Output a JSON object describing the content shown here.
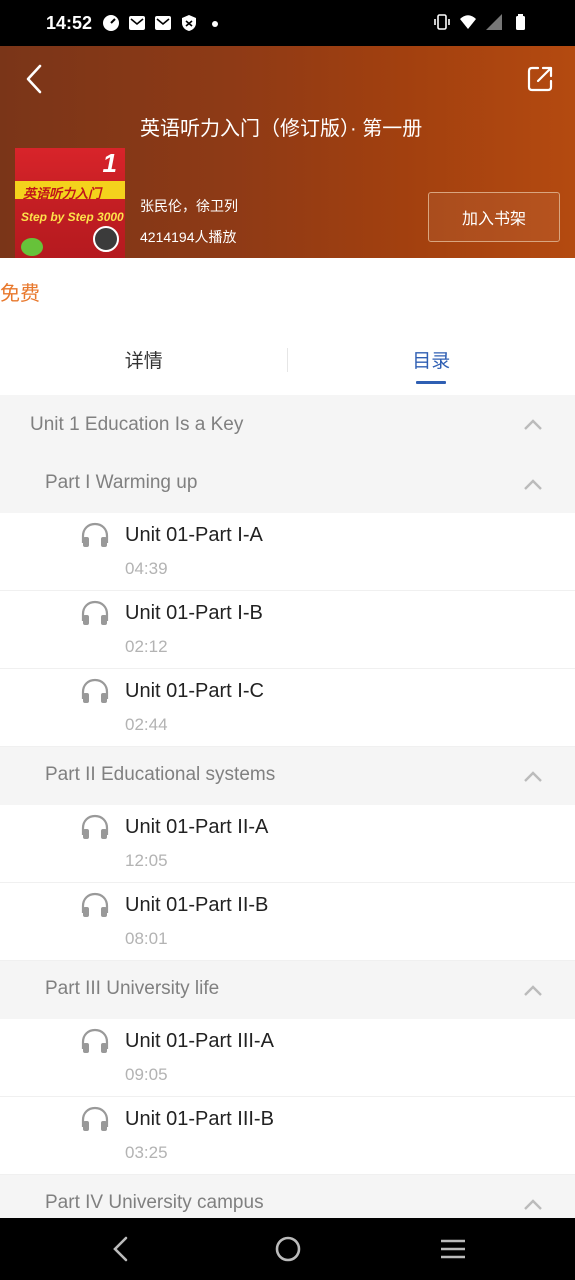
{
  "status_bar": {
    "time": "14:52",
    "left_icons": [
      "gauge-icon",
      "mail-icon",
      "mail-icon",
      "shield-icon",
      "dot-icon"
    ],
    "right_icons": [
      "vibrate-icon",
      "wifi-icon",
      "signal-icon",
      "battery-icon"
    ]
  },
  "header": {
    "title": "英语听力入门（修订版）· 第一册",
    "authors": "张民伦，徐卫列",
    "plays": "4214194人播放",
    "add_shelf_label": "加入书架",
    "cover": {
      "number": "1",
      "title": "英语听力入门",
      "subtitle": "Step by Step 3000"
    },
    "background_colors": [
      "#7a3518",
      "#b44a10"
    ]
  },
  "price": "免费",
  "tabs": [
    {
      "label": "详情",
      "active": false
    },
    {
      "label": "目录",
      "active": true
    }
  ],
  "toc": {
    "unit": "Unit 1 Education Is a Key",
    "parts": [
      {
        "title": "Part I Warming up",
        "tracks": [
          {
            "name": "Unit 01-Part I-A",
            "duration": "04:39"
          },
          {
            "name": "Unit 01-Part I-B",
            "duration": "02:12"
          },
          {
            "name": "Unit 01-Part I-C",
            "duration": "02:44"
          }
        ]
      },
      {
        "title": "Part II Educational systems",
        "tracks": [
          {
            "name": "Unit 01-Part II-A",
            "duration": "12:05"
          },
          {
            "name": "Unit 01-Part II-B",
            "duration": "08:01"
          }
        ]
      },
      {
        "title": "Part III University life",
        "tracks": [
          {
            "name": "Unit 01-Part III-A",
            "duration": "09:05"
          },
          {
            "name": "Unit 01-Part III-B",
            "duration": "03:25"
          }
        ]
      },
      {
        "title": "Part IV University campus",
        "tracks": []
      }
    ]
  },
  "colors": {
    "accent_blue": "#2f5fb3",
    "price_orange": "#e8782c"
  },
  "nav_bar": {
    "icons": [
      "back-nav-icon",
      "home-nav-icon",
      "recents-nav-icon"
    ]
  }
}
